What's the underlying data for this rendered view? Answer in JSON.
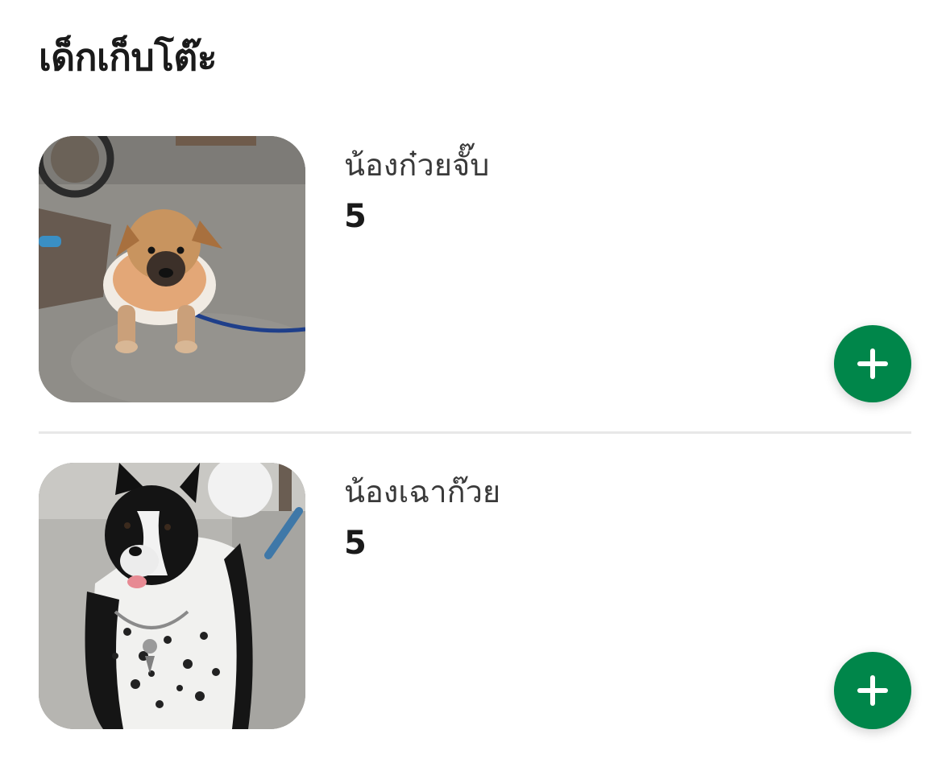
{
  "section": {
    "title": "เด็กเก็บโต๊ะ"
  },
  "items": [
    {
      "name": "น้องก๋วยจั๊บ",
      "price": "5",
      "photo_alt": "tan puppy in sweater on leash"
    },
    {
      "name": "น้องเฉาก๊วย",
      "price": "5",
      "photo_alt": "black and white spotted dog"
    }
  ],
  "colors": {
    "add_button": "#00864a",
    "divider": "#e8e8e8"
  },
  "icons": {
    "add": "plus-icon"
  }
}
